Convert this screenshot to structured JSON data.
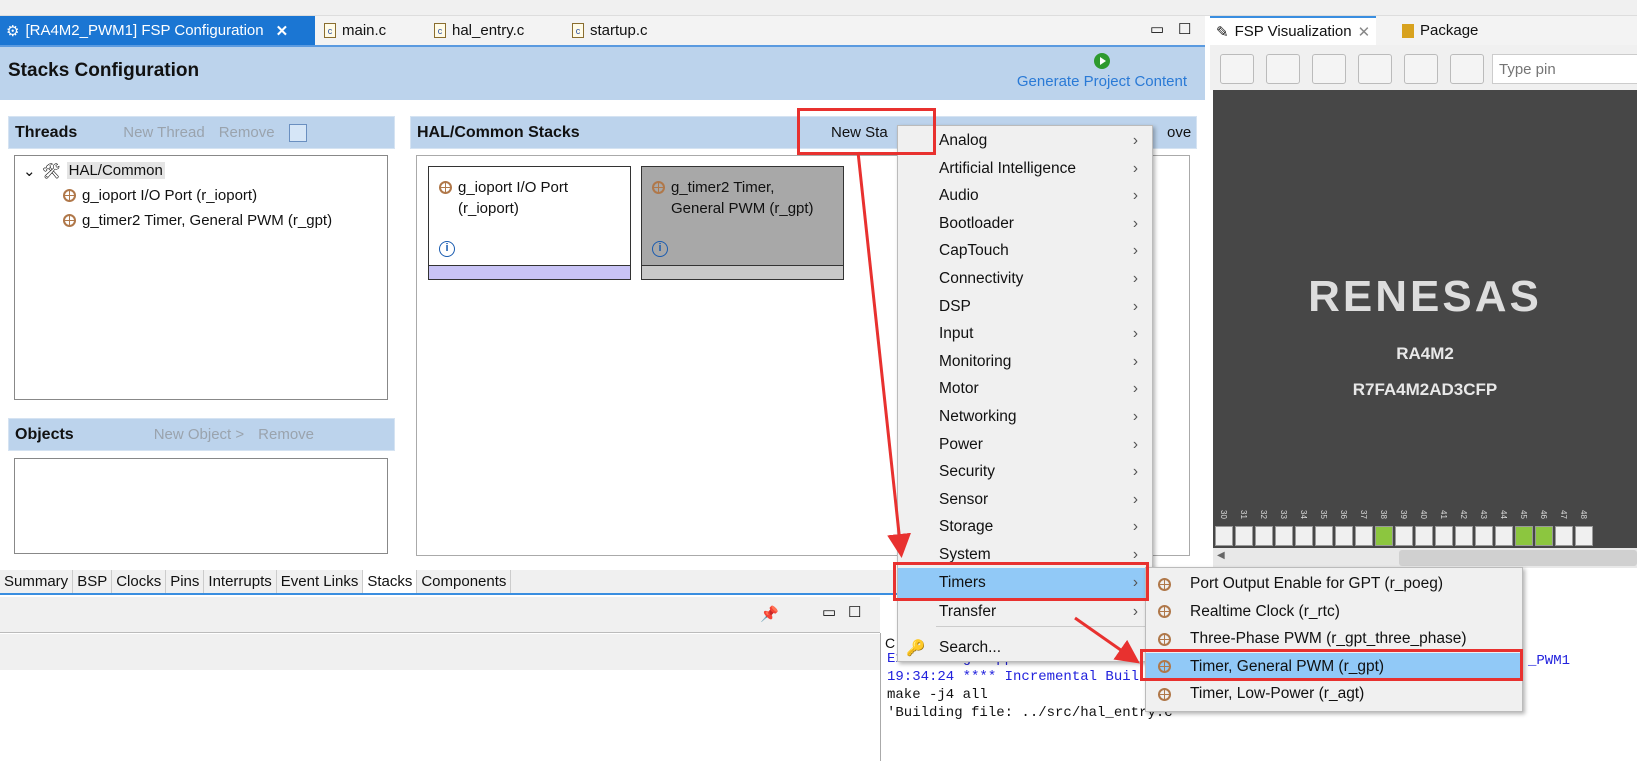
{
  "editor_tabs": [
    {
      "label": "[RA4M2_PWM1] FSP Configuration",
      "active": true
    },
    {
      "label": "main.c"
    },
    {
      "label": "hal_entry.c"
    },
    {
      "label": "startup.c"
    }
  ],
  "header": {
    "title": "Stacks Configuration",
    "generate": "Generate Project Content"
  },
  "threads": {
    "title": "Threads",
    "new": "New Thread",
    "remove": "Remove",
    "tree": {
      "root": "HAL/Common",
      "children": [
        "g_ioport I/O Port (r_ioport)",
        "g_timer2 Timer, General PWM (r_gpt)"
      ]
    }
  },
  "objects": {
    "title": "Objects",
    "new": "New Object >",
    "remove": "Remove"
  },
  "stacks": {
    "title": "HAL/Common Stacks",
    "new": "New Sta",
    "remove": "ove",
    "cards": [
      {
        "line1": "g_ioport I/O Port",
        "line2": "(r_ioport)",
        "bar_color": "#c8c3f5"
      },
      {
        "line1": "g_timer2 Timer,",
        "line2": "General PWM (r_gpt)",
        "bar_color": "#c8c8c8"
      }
    ]
  },
  "bottom_tabs": [
    "Summary",
    "BSP",
    "Clocks",
    "Pins",
    "Interrupts",
    "Event Links",
    "Stacks",
    "Components"
  ],
  "active_bottom_tab": "Stacks",
  "menu": {
    "items": [
      "Analog",
      "Artificial Intelligence",
      "Audio",
      "Bootloader",
      "CapTouch",
      "Connectivity",
      "DSP",
      "Input",
      "Monitoring",
      "Motor",
      "Networking",
      "Power",
      "Security",
      "Sensor",
      "Storage",
      "System",
      "Timers",
      "Transfer"
    ],
    "highlighted": "Timers",
    "search": "Search..."
  },
  "submenu": {
    "items": [
      "Port Output Enable for GPT (r_poeg)",
      "Realtime Clock (r_rtc)",
      "Three-Phase PWM (r_gpt_three_phase)",
      "Timer, General PWM (r_gpt)",
      "Timer, Low-Power (r_agt)"
    ],
    "highlighted": "Timer, General PWM (r_gpt)"
  },
  "right_panel": {
    "tabs": [
      "FSP Visualization",
      "Package"
    ],
    "search_placeholder": "Type pin",
    "logo": "RENESAS",
    "chip": "RA4M2",
    "part": "R7FA4M2AD3CFP",
    "pins": [
      "30",
      "31",
      "32",
      "33",
      "34",
      "35",
      "36",
      "37",
      "38",
      "39",
      "40",
      "41",
      "42",
      "43",
      "44",
      "45",
      "46",
      "47",
      "48"
    ],
    "active_pins": [
      "38",
      "45",
      "46"
    ]
  },
  "console": {
    "tab": "C",
    "lines": [
      "Extracting support files...",
      "19:34:24 **** Incremental Buil",
      "make -j4 all",
      "'Building file: ../src/hal_entry.c'"
    ],
    "line2_tail": "_PWM1"
  },
  "colors": {
    "accent": "#1b76d3",
    "highlight": "#91c9f7",
    "annotation": "#e8312f",
    "pin_active": "#8cc63f"
  }
}
